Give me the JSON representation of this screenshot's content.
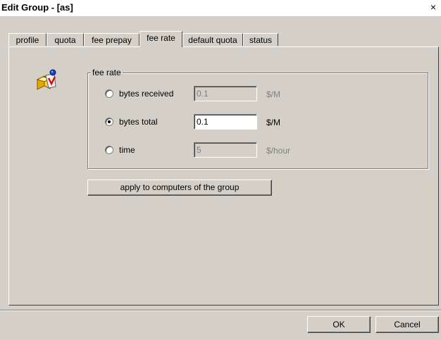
{
  "window": {
    "title": "Edit Group - [as]",
    "close_glyph": "×"
  },
  "tabs": [
    {
      "label": "profile",
      "active": false
    },
    {
      "label": "quota",
      "active": false
    },
    {
      "label": "fee prepay",
      "active": false
    },
    {
      "label": "fee rate",
      "active": true
    },
    {
      "label": "default quota",
      "active": false
    },
    {
      "label": "status",
      "active": false
    }
  ],
  "fee_rate": {
    "group_label": "fee rate",
    "options": [
      {
        "label": "bytes received",
        "value": "0.1",
        "unit": "$/M",
        "selected": false,
        "enabled": false
      },
      {
        "label": "bytes total",
        "value": "0.1",
        "unit": "$/M",
        "selected": true,
        "enabled": true
      },
      {
        "label": "time",
        "value": "5",
        "unit": "$/hour",
        "selected": false,
        "enabled": false
      }
    ]
  },
  "apply_button": "apply to computers of the group",
  "footer": {
    "ok_label": "OK",
    "cancel_label": "Cancel"
  },
  "icons": {
    "app_icon": "group-fee-icon"
  }
}
